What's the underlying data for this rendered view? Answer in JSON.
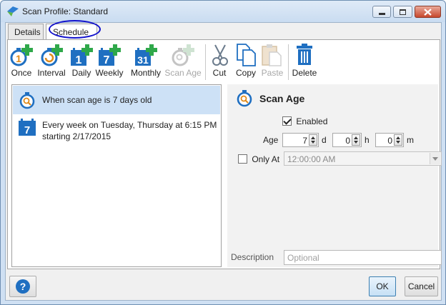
{
  "window": {
    "title": "Scan Profile: Standard",
    "controls": {
      "minimize": "minimize-icon",
      "maximize": "maximize-icon",
      "close": "close-icon"
    }
  },
  "tabs": [
    {
      "label": "Details",
      "active": false
    },
    {
      "label": "Schedule",
      "active": true
    }
  ],
  "toolbar": {
    "once": "Once",
    "interval": "Interval",
    "daily": "Daily",
    "weekly": "Weekly",
    "monthly": "Monthly",
    "scan_age": "Scan Age",
    "cut": "Cut",
    "copy": "Copy",
    "paste": "Paste",
    "delete": "Delete",
    "daily_icon_text": "1",
    "weekly_icon_text": "7",
    "monthly_icon_text": "31"
  },
  "schedules": [
    {
      "line1": "When scan age is 7 days old",
      "line2": "",
      "icon": "stopwatch-icon",
      "selected": true
    },
    {
      "line1": "Every week on Tuesday, Thursday at 6:15 PM",
      "line2": "starting 2/17/2015",
      "icon": "calendar-icon",
      "icon_text": "7",
      "selected": false
    }
  ],
  "details": {
    "title": "Scan Age",
    "enabled_label": "Enabled",
    "enabled_checked": true,
    "age_label": "Age",
    "days": "7",
    "days_unit": "d",
    "hours": "0",
    "hours_unit": "h",
    "minutes": "0",
    "minutes_unit": "m",
    "only_at_label": "Only At",
    "only_at_checked": false,
    "only_at_time": "12:00:00 AM",
    "description_label": "Description",
    "description_placeholder": "Optional"
  },
  "footer": {
    "help_icon": "question-mark",
    "ok": "OK",
    "cancel": "Cancel"
  },
  "colors": {
    "accent_blue": "#1f6fc1",
    "green_plus": "#2fa84a",
    "selection": "#cde1f6",
    "tab_highlight": "#1111cc"
  }
}
